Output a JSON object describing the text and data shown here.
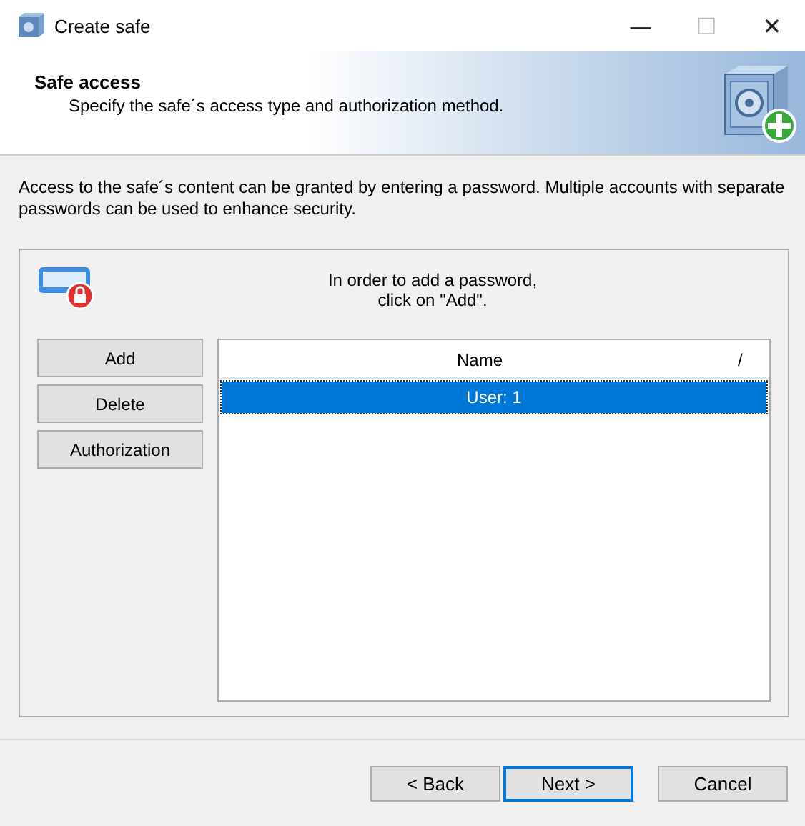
{
  "window": {
    "title": "Create safe",
    "controls": [
      "—",
      "☐",
      "✕"
    ]
  },
  "header": {
    "title": "Safe access",
    "subtitle": "Specify the safe´s access type and authorization method."
  },
  "description": "Access to the safe´s content can be granted by entering a password. Multiple accounts with separate passwords can be used to enhance security.",
  "group": {
    "hint": "In order to add a password,\nclick on \"Add\".",
    "buttons": [
      "Add",
      "Delete",
      "Authorization"
    ],
    "list": {
      "columns": [
        {
          "label": "Name",
          "sort": "/"
        }
      ],
      "rows": [
        {
          "name": "User: 1",
          "selected": true
        }
      ]
    }
  },
  "footer_buttons": [
    {
      "label": "< Back",
      "default": false
    },
    {
      "label": "Next >",
      "default": true
    },
    {
      "label": "Cancel",
      "default": false
    }
  ]
}
